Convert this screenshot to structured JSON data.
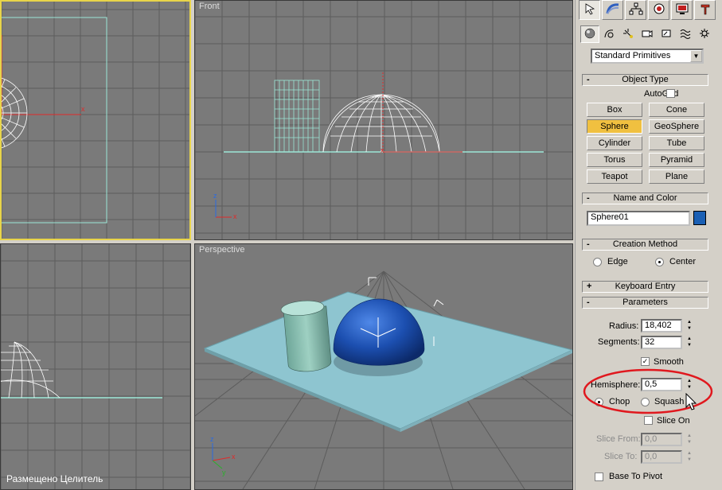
{
  "viewports": {
    "front_label": "Front",
    "perspective_label": "Perspective",
    "watermark": "Размещено Целитель"
  },
  "command_panel": {
    "tab_icons": [
      "create-icon",
      "modify-icon",
      "hierarchy-icon",
      "motion-icon",
      "display-icon",
      "utilities-icon"
    ],
    "subtab_icons": [
      "geometry-icon",
      "shapes-icon",
      "lights-icon",
      "cameras-icon",
      "helpers-icon",
      "spacewarps-icon",
      "systems-icon"
    ],
    "category_dropdown": "Standard Primitives",
    "object_type": {
      "title": "Object Type",
      "autogrid_label": "AutoGrid",
      "buttons": [
        "Box",
        "Cone",
        "Sphere",
        "GeoSphere",
        "Cylinder",
        "Tube",
        "Torus",
        "Pyramid",
        "Teapot",
        "Plane"
      ],
      "active_button": "Sphere"
    },
    "name_and_color": {
      "title": "Name and Color",
      "name_value": "Sphere01",
      "color": "#1a5fb4"
    },
    "creation_method": {
      "title": "Creation Method",
      "edge_label": "Edge",
      "center_label": "Center",
      "selected": "Center"
    },
    "keyboard_entry": {
      "title": "Keyboard Entry"
    },
    "parameters": {
      "title": "Parameters",
      "radius_label": "Radius:",
      "radius_value": "18,402",
      "segments_label": "Segments:",
      "segments_value": "32",
      "smooth_label": "Smooth",
      "smooth_checked": true,
      "hemisphere_label": "Hemisphere:",
      "hemisphere_value": "0,5",
      "chop_label": "Chop",
      "squash_label": "Squash",
      "chop_selected": true,
      "slice_on_label": "Slice On",
      "slice_from_label": "Slice From:",
      "slice_from_value": "0,0",
      "slice_to_label": "Slice To:",
      "slice_to_value": "0,0",
      "base_to_pivot_label": "Base To Pivot"
    }
  },
  "colors": {
    "viewport_bg": "#7a7a7a",
    "grid_line": "#5a5a5a",
    "active_border": "#e8d44a",
    "wireframe": "#ffffff",
    "cylinder_wire": "#9be6d6",
    "plane": "#8ec5d0",
    "sphere_blue": "#1c4fb0",
    "highlight_ellipse": "#e0181e"
  }
}
